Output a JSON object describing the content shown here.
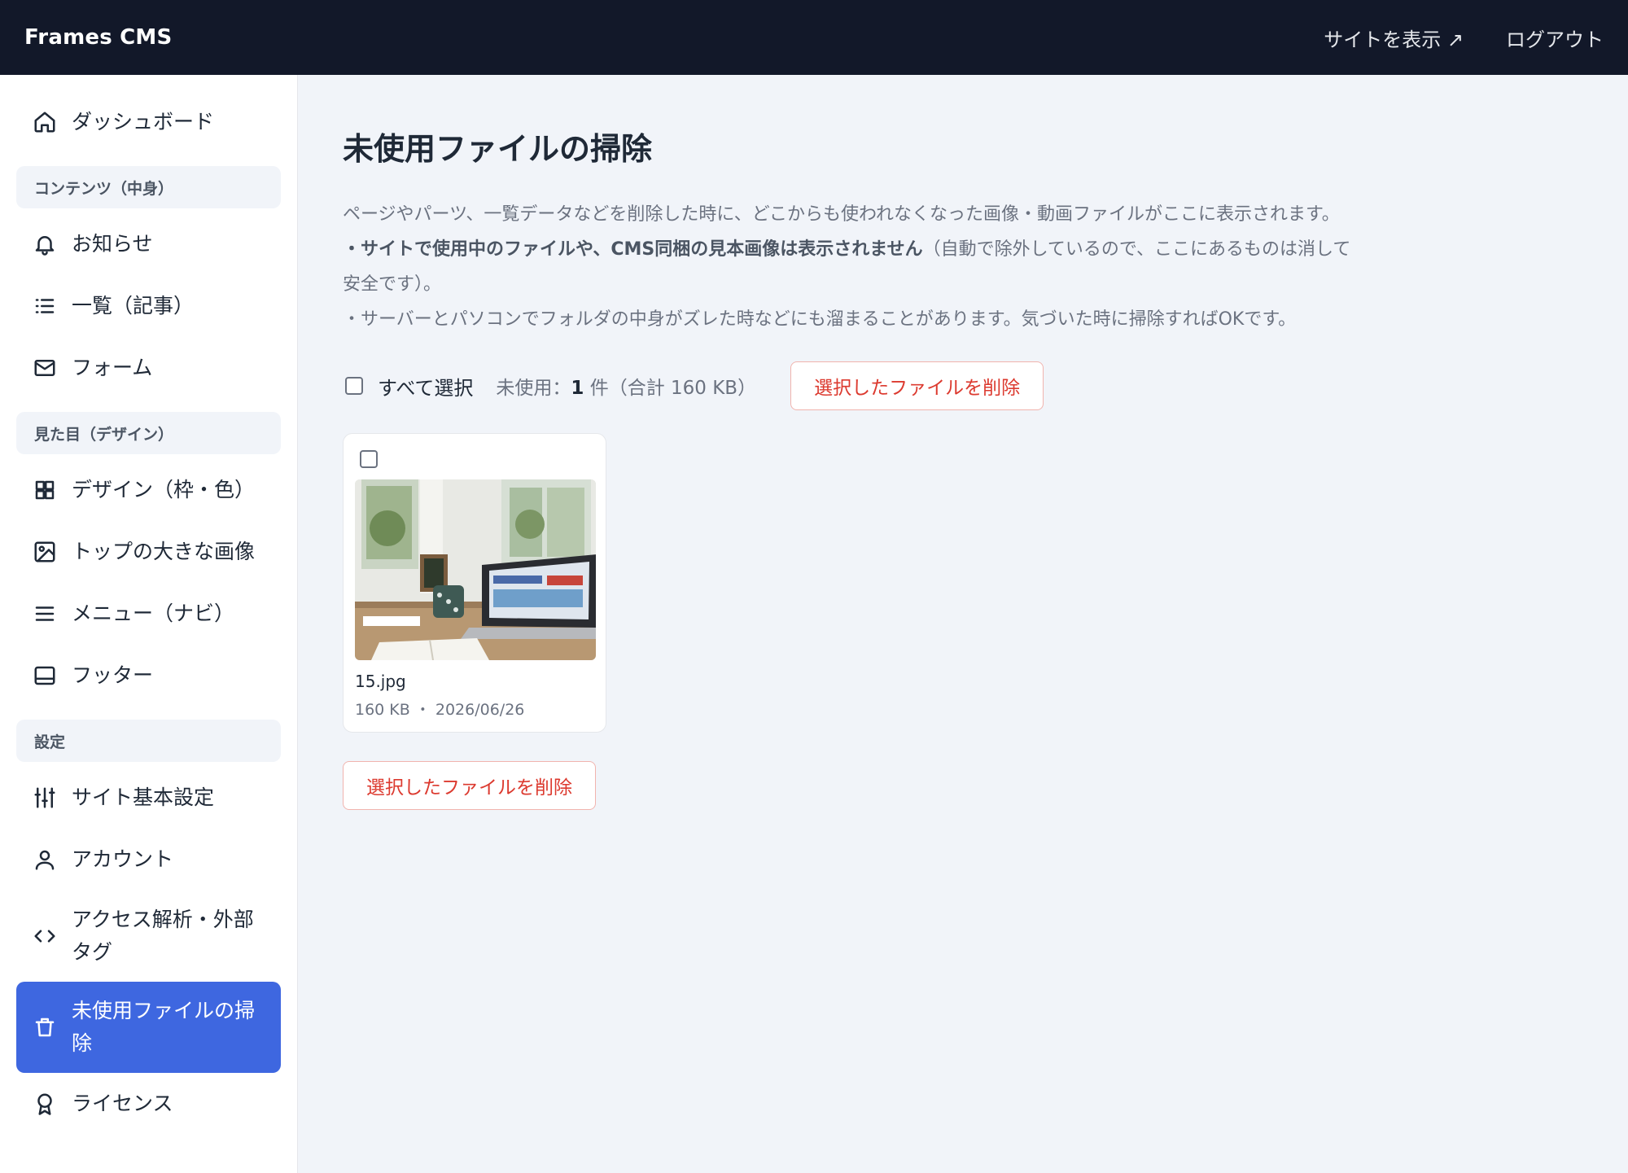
{
  "header": {
    "brand": "Frames CMS",
    "view_site": "サイトを表示 ↗",
    "logout": "ログアウト"
  },
  "sidebar": {
    "dashboard": "ダッシュボード",
    "section_content": "コンテンツ（中身）",
    "news": "お知らせ",
    "list": "一覧（記事）",
    "form": "フォーム",
    "section_design": "見た目（デザイン）",
    "design": "デザイン（枠・色）",
    "hero": "トップの大きな画像",
    "menu": "メニュー（ナビ）",
    "footer": "フッター",
    "section_settings": "設定",
    "site_settings": "サイト基本設定",
    "account": "アカウント",
    "analytics_line1": "アクセス解析・外部",
    "analytics_line2": "タグ",
    "cleanup_line1": "未使用ファイルの掃",
    "cleanup_line2": "除",
    "license": "ライセンス"
  },
  "main": {
    "title": "未使用ファイルの掃除",
    "desc_line1": "ページやパーツ、一覧データなどを削除した時に、どこからも使われなくなった画像・動画ファイルがここに表示されます。",
    "desc_line2_bold": "・サイトで使用中のファイルや、CMS同梱の見本画像は表示されません",
    "desc_line2_rest": "（自動で除外しているので、ここにあるものは消して",
    "desc_line3": "安全です）。",
    "desc_line4": "・サーバーとパソコンでフォルダの中身がズレた時などにも溜まることがあります。気づいた時に掃除すればOKです。",
    "select_all": "すべて選択",
    "unused_prefix": "未使用：",
    "unused_count": "1",
    "unused_suffix": " 件（合計 160 KB）",
    "delete_selected": "選択したファイルを削除",
    "files": [
      {
        "name": "15.jpg",
        "size": "160 KB",
        "date": "2026/06/26",
        "meta": "160 KB ・ 2026/06/26"
      }
    ]
  },
  "colors": {
    "topbar": "#121829",
    "accent": "#3e67e0",
    "danger": "#dc3a2f",
    "background": "#f1f4f9"
  }
}
